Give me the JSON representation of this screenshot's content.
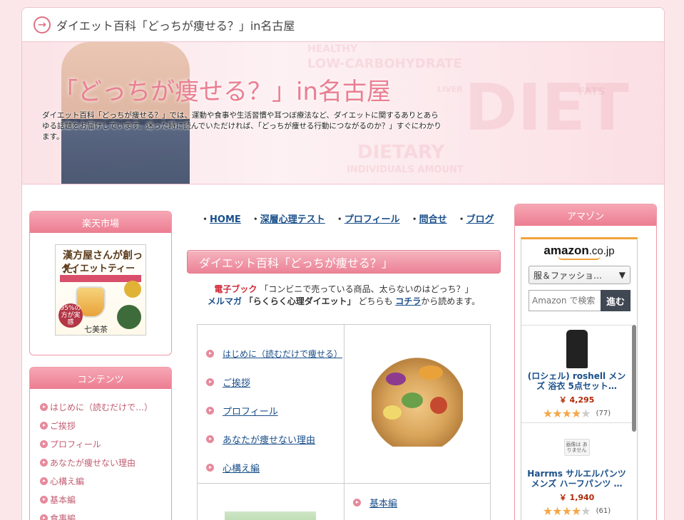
{
  "titlebar": {
    "title": "ダイエット百科「どっちが痩せる？」in名古屋"
  },
  "banner": {
    "title": "「どっちが痩せる？」in名古屋",
    "description": "ダイエット百科「どっちが痩せる？」では、運動や食事や生活習慣や耳つぼ療法など、ダイエットに関するありとあらゆる話題をお届けしています。迷った時に読んでいただければ、「どっちが痩せる行動につながるのか？」すぐにわかります。",
    "bg_words": [
      "HEALTHY",
      "LOW-CARBOHYDRATE",
      "DIETARY",
      "INDIVIDUALS AMOUNT",
      "DIET",
      "FATS",
      "LIVER"
    ]
  },
  "rakuten": {
    "heading": "楽天市場",
    "ad_line1": "漢方屋さんが創った、",
    "ad_line2": "ダイエットティー",
    "ad_badge": "95%の方が実感",
    "ad_footer": "七美茶"
  },
  "contents": {
    "heading": "コンテンツ",
    "items": [
      "はじめに（読むだけで…）",
      "ご挨拶",
      "プロフィール",
      "あなたが痩せない理由",
      "心構え編",
      "基本編",
      "食事編"
    ]
  },
  "nav": {
    "items": [
      "HOME",
      "深層心理テスト",
      "プロフィール",
      "問合せ",
      "ブログ"
    ]
  },
  "section_title": "ダイエット百科「どっちが痩せる？」",
  "intro": {
    "ebook_label": "電子ブック",
    "ebook_text": "「コンビニで売っている商品、太らないのはどっち？」",
    "mailmag_label": "メルマガ",
    "mailmag_text": "「らくらく心理ダイエット」",
    "tail_prefix": "どちらも",
    "link": "コチラ",
    "tail_suffix": "から読めます。"
  },
  "grid": {
    "links": [
      "はじめに（読むだけで痩せる）",
      "ご挨拶",
      "プロフィール",
      "あなたが痩せない理由",
      "心構え編"
    ],
    "second_link": "基本編"
  },
  "amazon": {
    "heading": "アマゾン",
    "logo": "amazon",
    "logo_suffix": ".co.jp",
    "category": "服＆ファッショ…",
    "search_placeholder": "Amazon で検索",
    "search_button": "進む",
    "items": [
      {
        "name": "(ロシェル) roshell メンズ 浴衣 5点セット…",
        "price": "￥ 4,295",
        "stars": 4,
        "count": "(77)"
      },
      {
        "name": "Harrms サルエルパンツ メンズ ハーフパンツ …",
        "price": "￥ 1,940",
        "stars": 4,
        "count": "(61)"
      }
    ],
    "no_image_text": "画像は ありません"
  }
}
